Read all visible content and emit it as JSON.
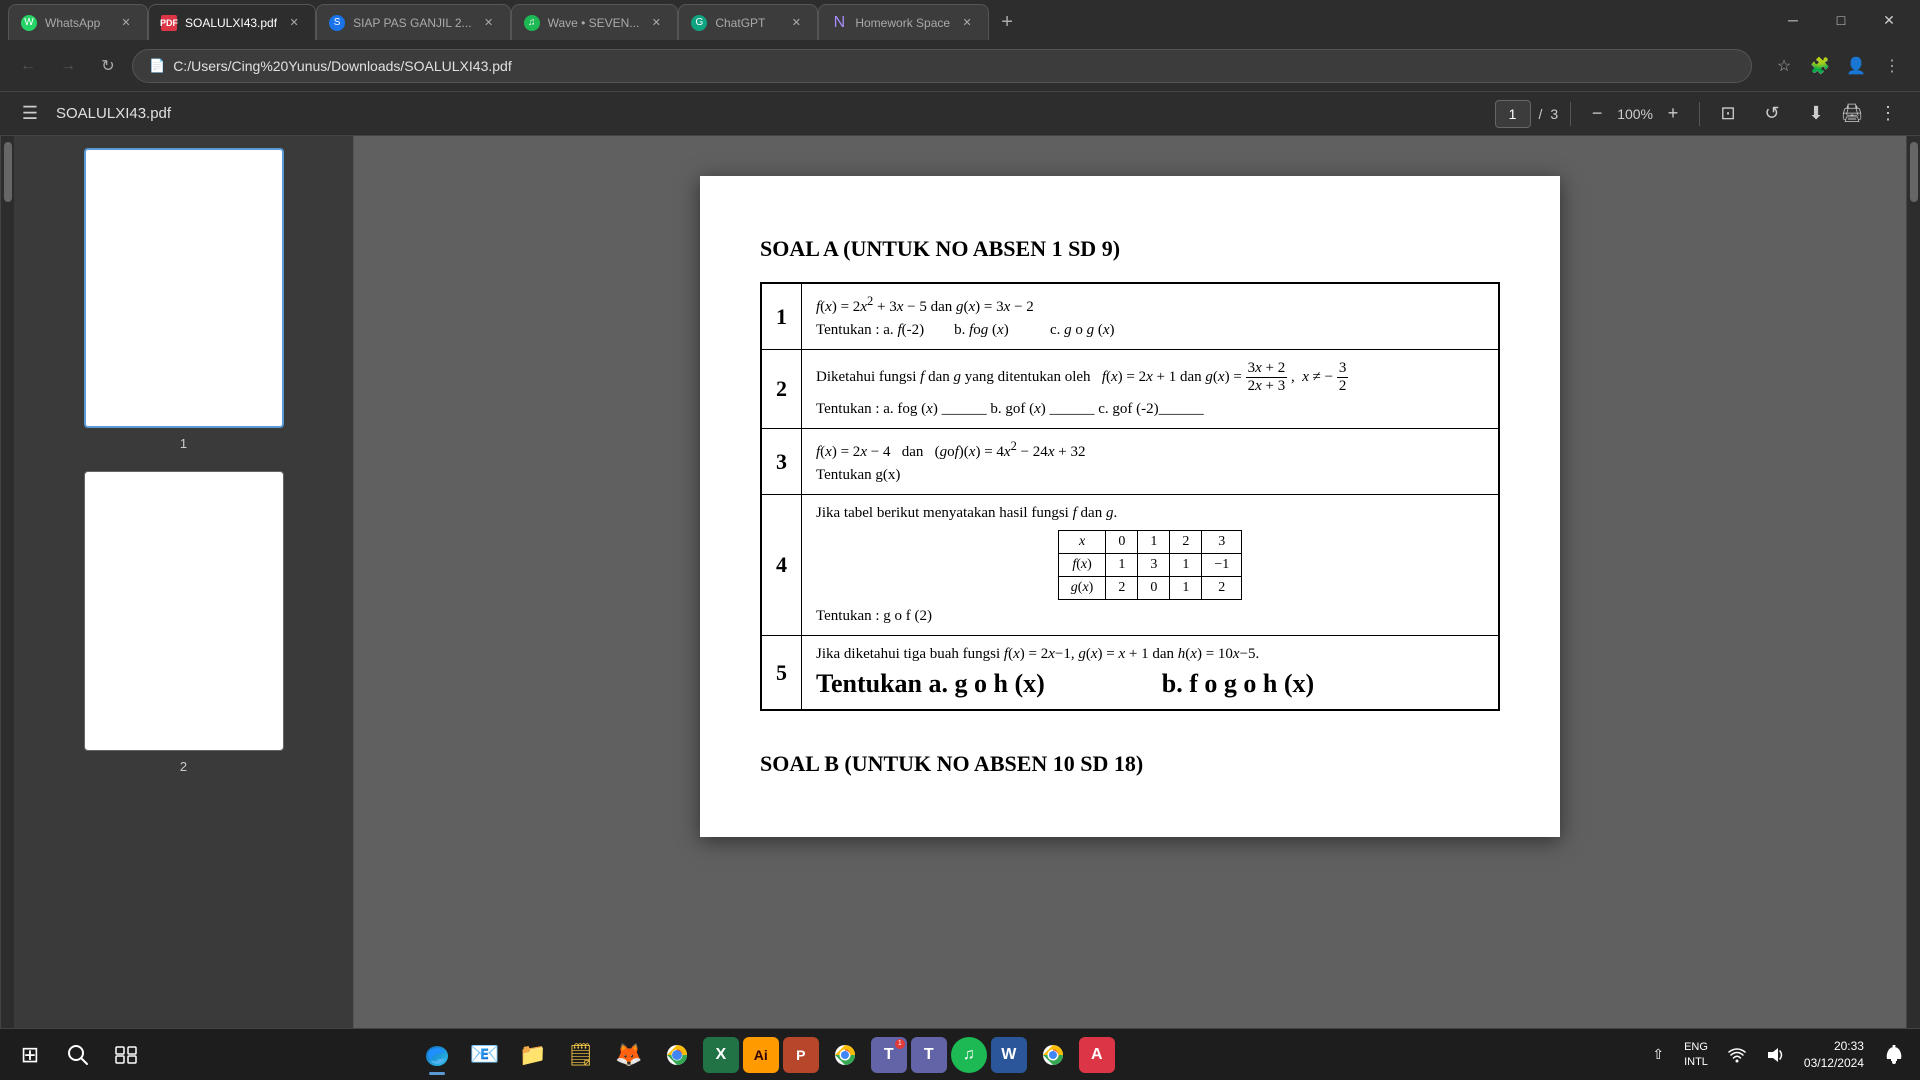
{
  "browser": {
    "tabs": [
      {
        "id": "whatsapp",
        "title": "WhatsApp",
        "favicon": "whatsapp",
        "active": false,
        "color": "#25D366"
      },
      {
        "id": "soal-pdf",
        "title": "SOALULXI43.pdf",
        "favicon": "pdf",
        "active": true,
        "color": "#dc3545"
      },
      {
        "id": "siap-pas",
        "title": "SIAP PAS GANJIL 2...",
        "favicon": "blue",
        "active": false,
        "color": "#1a73e8"
      },
      {
        "id": "wave",
        "title": "Wave • SEVEN...",
        "favicon": "spotify",
        "active": false,
        "color": "#1DB954"
      },
      {
        "id": "chatgpt",
        "title": "ChatGPT",
        "favicon": "chatgpt",
        "active": false,
        "color": "#10a37f"
      },
      {
        "id": "homework",
        "title": "Homework Space",
        "favicon": "homework",
        "active": false,
        "color": "#a78bfa"
      }
    ],
    "url": "C:/Users/Cing%20Yunus/Downloads/SOALULXI43.pdf",
    "page_current": "1",
    "page_total": "3",
    "zoom": "100%"
  },
  "pdf": {
    "title": "SOALULXI43.pdf",
    "soal_a_title": "SOAL A (UNTUK NO ABSEN 1 SD 9)",
    "soal_b_title": "SOAL B (UNTUK NO ABSEN 10 SD 18)",
    "questions": [
      {
        "num": "1",
        "content_line1": "f(x) = 2x² + 3x − 5 dan g(x) = 3x − 2",
        "content_line2": "Tentukan : a. f(-2)        b. fog (x)        c. g o g (x)"
      },
      {
        "num": "2",
        "content_line1": "Diketahui fungsi f dan g yang ditentukan oleh f(x) = 2x + 1 dan g(x) = (3x+2)/(2x+3), x ≠ -3/2",
        "content_line2": "Tentukan : a. fog (x) _____ b. gof (x) _____ c. gof (-2)_____"
      },
      {
        "num": "3",
        "content_line1": "f(x) = 2x − 4 dan (gof)(x) = 4x² − 24x + 32",
        "content_line2": "Tentukan g(x)"
      },
      {
        "num": "4",
        "content_line1": "Jika tabel berikut menyatakan hasil fungsi f dan g.",
        "table": {
          "headers": [
            "x",
            "0",
            "1",
            "2",
            "3"
          ],
          "row1_label": "f(x)",
          "row1_vals": [
            "1",
            "3",
            "1",
            "−1"
          ],
          "row2_label": "g(x)",
          "row2_vals": [
            "2",
            "0",
            "1",
            "2"
          ]
        },
        "content_line2": "Tentukan : g o f (2)"
      },
      {
        "num": "5",
        "content_line1": "Jika diketahui tiga buah fungsi f(x) = 2x−1, g(x) = x + 1 dan h(x) = 10x−5.",
        "content_line2": "Tentukan a. g o h (x)         b. f o g o h (x)"
      }
    ]
  },
  "taskbar": {
    "apps": [
      {
        "id": "windows",
        "label": "Windows Start",
        "icon": "⊞"
      },
      {
        "id": "search",
        "label": "Search",
        "icon": "🔍"
      },
      {
        "id": "taskview",
        "label": "Task View",
        "icon": "⧉"
      },
      {
        "id": "edge",
        "label": "Edge (active)",
        "icon": "⬡",
        "active": true
      },
      {
        "id": "outlook",
        "label": "Outlook",
        "icon": "📧"
      },
      {
        "id": "files",
        "label": "File Explorer",
        "icon": "📁"
      },
      {
        "id": "sticky",
        "label": "Sticky Notes",
        "icon": "📌"
      },
      {
        "id": "firefox",
        "label": "Firefox",
        "icon": "🦊"
      },
      {
        "id": "chrome",
        "label": "Chrome",
        "icon": "⊙"
      },
      {
        "id": "excel",
        "label": "Excel",
        "icon": "📊"
      },
      {
        "id": "illustrator",
        "label": "Illustrator",
        "icon": "🎨"
      },
      {
        "id": "powerpoint",
        "label": "PowerPoint",
        "icon": "📽"
      },
      {
        "id": "chrome2",
        "label": "Chrome 2",
        "icon": "⊙"
      },
      {
        "id": "teams1",
        "label": "Teams 1",
        "icon": "T"
      },
      {
        "id": "teams2",
        "label": "Teams 2",
        "icon": "T"
      },
      {
        "id": "spotify",
        "label": "Spotify",
        "icon": "♫"
      },
      {
        "id": "word",
        "label": "Word",
        "icon": "W"
      },
      {
        "id": "chrome3",
        "label": "Chrome 3",
        "icon": "⊙"
      },
      {
        "id": "acrobat",
        "label": "Acrobat",
        "icon": "A"
      }
    ],
    "system_tray": {
      "language": "ENG\nINTL",
      "time": "20:33",
      "date": "03/12/2024",
      "wifi_icon": "WiFi",
      "volume_icon": "🔊",
      "battery_icon": "🔋",
      "notification_icon": "🔔"
    }
  }
}
